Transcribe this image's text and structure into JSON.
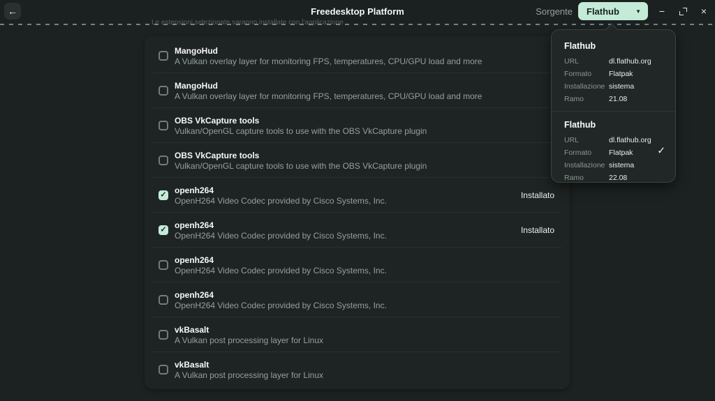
{
  "window": {
    "title": "Freedesktop Platform",
    "source_label": "Sorgente",
    "source_value": "Flathub"
  },
  "subtitle": "Le estensioni selezionate saranno installate con l'applicazione",
  "icons": {
    "back": "←",
    "dropdown": "▼",
    "minimize": "−",
    "close": "×",
    "check": "✓"
  },
  "addons": [
    {
      "name": "MangoHud",
      "description": "A Vulkan overlay layer for monitoring FPS, temperatures, CPU/GPU load and more",
      "checked": false,
      "status": ""
    },
    {
      "name": "MangoHud",
      "description": "A Vulkan overlay layer for monitoring FPS, temperatures, CPU/GPU load and more",
      "checked": false,
      "status": ""
    },
    {
      "name": "OBS VkCapture tools",
      "description": "Vulkan/OpenGL capture tools to use with the OBS VkCapture plugin",
      "checked": false,
      "status": ""
    },
    {
      "name": "OBS VkCapture tools",
      "description": "Vulkan/OpenGL capture tools to use with the OBS VkCapture plugin",
      "checked": false,
      "status": ""
    },
    {
      "name": "openh264",
      "description": "OpenH264 Video Codec provided by Cisco Systems, Inc.",
      "checked": true,
      "status": "Installato"
    },
    {
      "name": "openh264",
      "description": "OpenH264 Video Codec provided by Cisco Systems, Inc.",
      "checked": true,
      "status": "Installato"
    },
    {
      "name": "openh264",
      "description": "OpenH264 Video Codec provided by Cisco Systems, Inc.",
      "checked": false,
      "status": ""
    },
    {
      "name": "openh264",
      "description": "OpenH264 Video Codec provided by Cisco Systems, Inc.",
      "checked": false,
      "status": ""
    },
    {
      "name": "vkBasalt",
      "description": "A Vulkan post processing layer for Linux",
      "checked": false,
      "status": ""
    },
    {
      "name": "vkBasalt",
      "description": "A Vulkan post processing layer for Linux",
      "checked": false,
      "status": ""
    }
  ],
  "popover": {
    "sources": [
      {
        "title": "Flathub",
        "selected": false,
        "fields": [
          {
            "label": "URL",
            "value": "dl.flathub.org"
          },
          {
            "label": "Formato",
            "value": "Flatpak"
          },
          {
            "label": "Installazione",
            "value": "sistema"
          },
          {
            "label": "Ramo",
            "value": "21.08"
          }
        ]
      },
      {
        "title": "Flathub",
        "selected": true,
        "fields": [
          {
            "label": "URL",
            "value": "dl.flathub.org"
          },
          {
            "label": "Formato",
            "value": "Flatpak"
          },
          {
            "label": "Installazione",
            "value": "sistema"
          },
          {
            "label": "Ramo",
            "value": "22.08"
          }
        ]
      }
    ]
  },
  "colors": {
    "page_bg": "#1c2221",
    "card_bg": "#1e2423",
    "popover_bg": "#202726",
    "accent": "#c3ebd7",
    "accent_text": "#182320",
    "title_text": "#f7f9f8",
    "secondary_text": "#969f9c",
    "divider": "#2a302e"
  }
}
